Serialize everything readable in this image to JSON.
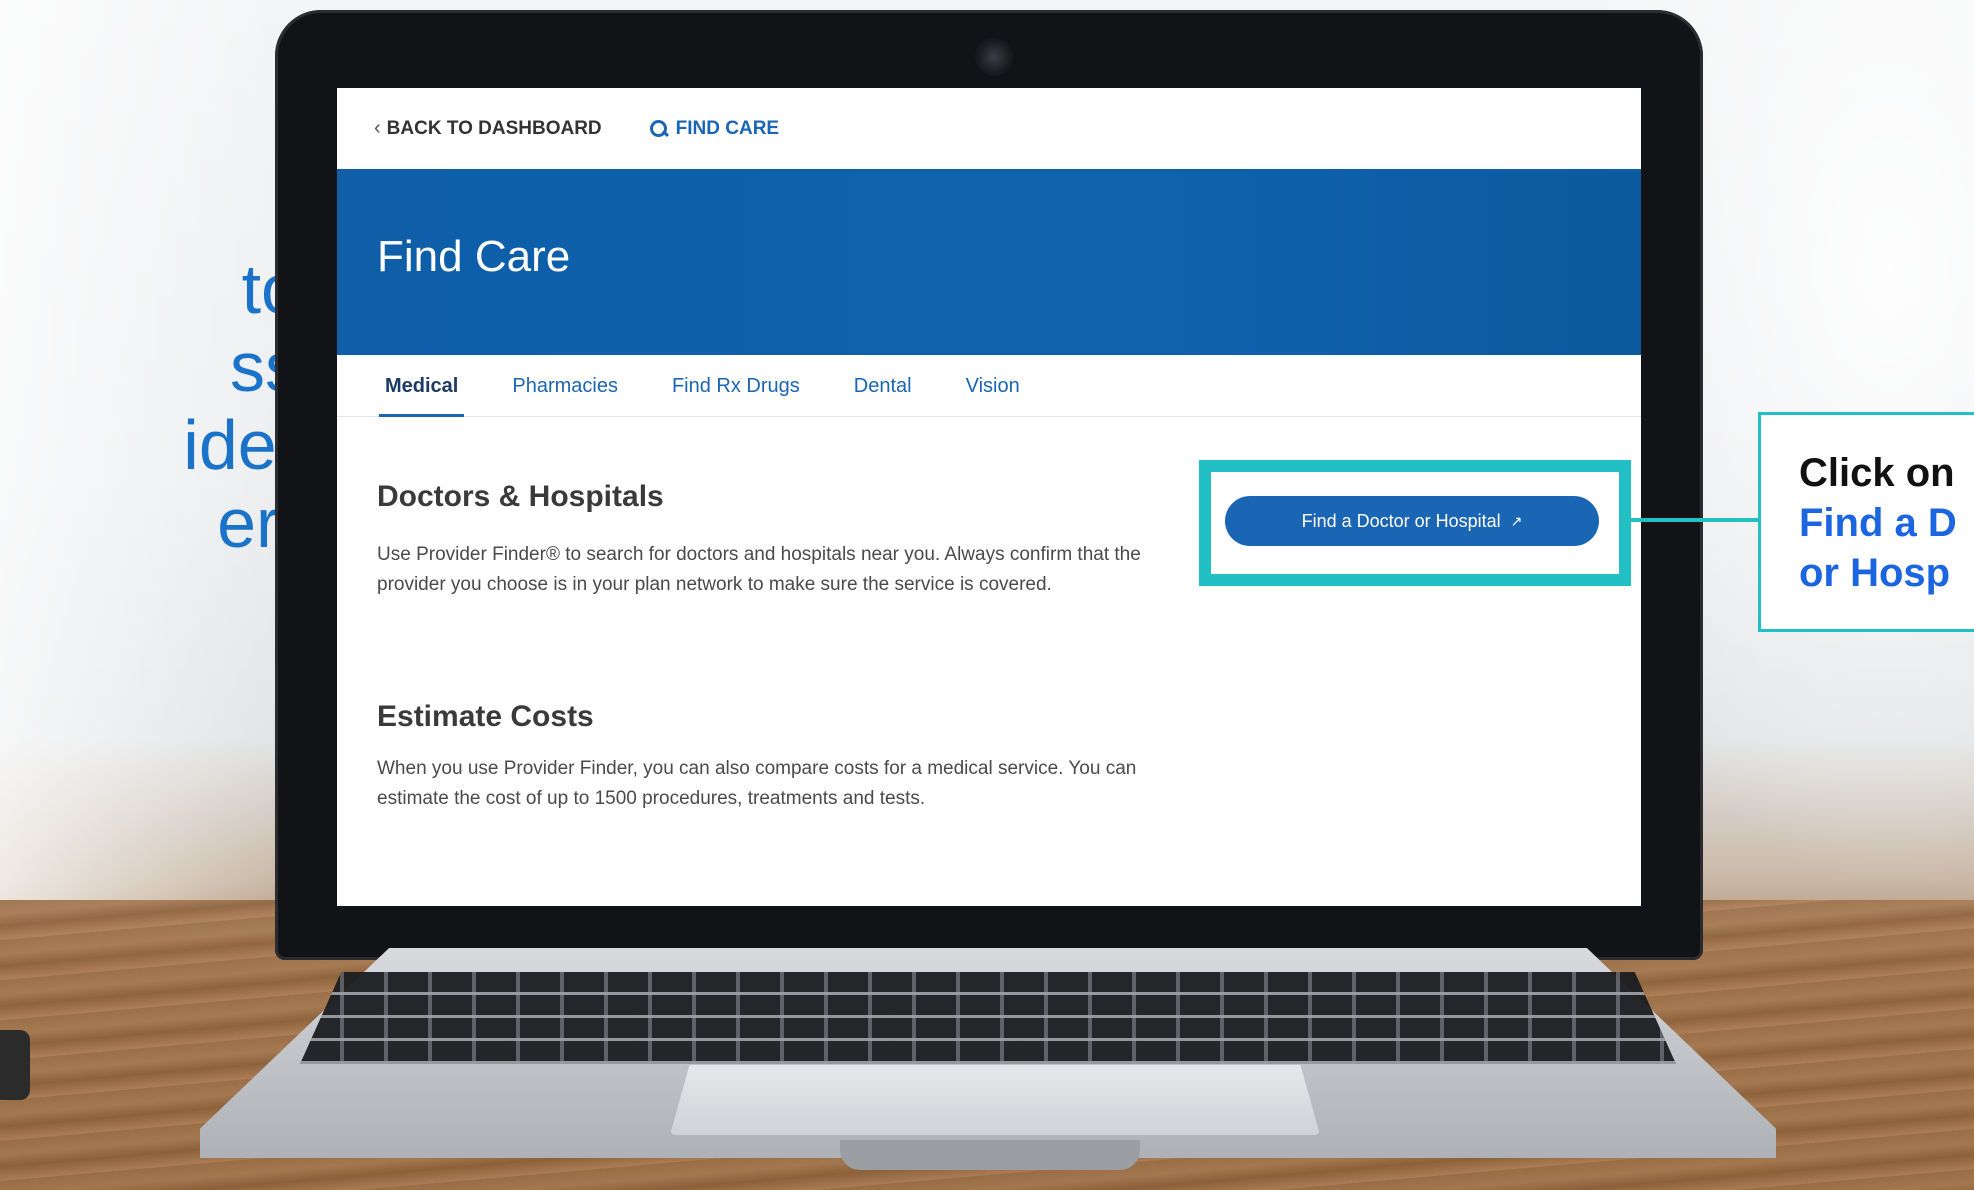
{
  "left_caption": {
    "line1": "to",
    "line2": "ss",
    "line3": "ider",
    "line4": "er",
    "reg_mark": "®"
  },
  "nav": {
    "back_label": "BACK TO DASHBOARD",
    "find_care_label": "FIND CARE"
  },
  "hero": {
    "title": "Find Care"
  },
  "tabs": [
    {
      "label": "Medical",
      "active": true
    },
    {
      "label": "Pharmacies",
      "active": false
    },
    {
      "label": "Find Rx Drugs",
      "active": false
    },
    {
      "label": "Dental",
      "active": false
    },
    {
      "label": "Vision",
      "active": false
    }
  ],
  "doctors": {
    "title": "Doctors & Hospitals",
    "body": "Use Provider Finder® to search for doctors and hospitals near you. Always confirm that the provider you choose is in your plan network to make sure the service is covered.",
    "button_label": "Find a Doctor or Hospital"
  },
  "estimate": {
    "title": "Estimate Costs",
    "body": "When you use Provider Finder, you can also compare costs for a medical service. You can estimate the cost of up to 1500 procedures, treatments and tests."
  },
  "callout": {
    "line1": "Click on",
    "line2": "Find a D",
    "line3": "or Hosp"
  },
  "colors": {
    "brand_blue": "#1b65b5",
    "hero_blue": "#0e5ea8",
    "highlight_teal": "#22bfc5",
    "callout_blue": "#1b65e0"
  },
  "icons": {
    "back": "chevron-left-icon",
    "find_care": "search-icon",
    "button": "external-link-icon"
  }
}
